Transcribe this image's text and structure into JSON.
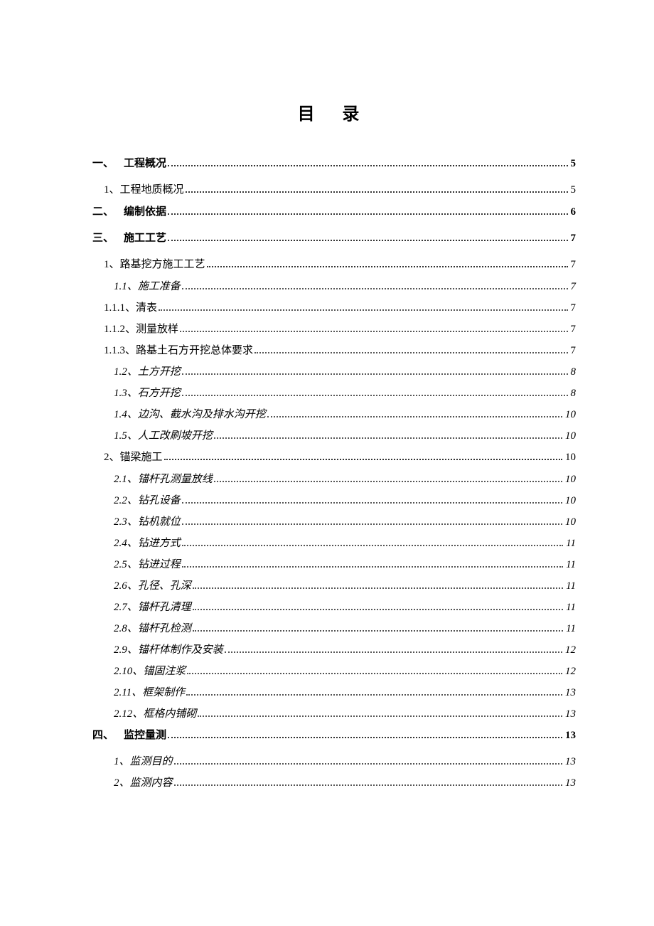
{
  "title": "目 录",
  "toc": [
    {
      "cls": "lvl1",
      "marker": "一、",
      "label": "工程概况",
      "page": "5"
    },
    {
      "cls": "lvl2",
      "marker": "1、",
      "label": "工程地质概况",
      "page": "5"
    },
    {
      "cls": "lvl1",
      "marker": "二、",
      "label": "编制依据",
      "page": "6"
    },
    {
      "cls": "lvl1",
      "marker": "三、",
      "label": "施工工艺",
      "page": "7"
    },
    {
      "cls": "lvl2",
      "marker": "1、",
      "label": "路基挖方施工工艺",
      "page": "7"
    },
    {
      "cls": "lvl3",
      "marker": "1.1、",
      "label": "施工准备 ",
      "page": "7"
    },
    {
      "cls": "lvl3b",
      "marker": "1.1.1、",
      "label": "清表",
      "page": "7"
    },
    {
      "cls": "lvl3b",
      "marker": "1.1.2、",
      "label": "测量放样",
      "page": "7"
    },
    {
      "cls": "lvl3b",
      "marker": "1.1.3、",
      "label": "路基土石方开挖总体要求",
      "page": "7"
    },
    {
      "cls": "lvl3",
      "marker": "1.2、",
      "label": "土方开挖 ",
      "page": "8"
    },
    {
      "cls": "lvl3",
      "marker": "1.3、",
      "label": "石方开挖 ",
      "page": "8"
    },
    {
      "cls": "lvl3",
      "marker": "1.4、",
      "label": "边沟、截水沟及排水沟开挖 ",
      "page": "10"
    },
    {
      "cls": "lvl3",
      "marker": "1.5、",
      "label": "人工改刷坡开挖 ",
      "page": "10"
    },
    {
      "cls": "lvl2",
      "marker": "2、",
      "label": "锚梁施工",
      "page": "10"
    },
    {
      "cls": "lvl3",
      "marker": "2.1、",
      "label": "锚杆孔测量放线 ",
      "page": "10"
    },
    {
      "cls": "lvl3",
      "marker": "2.2、",
      "label": "钻孔设备 ",
      "page": "10"
    },
    {
      "cls": "lvl3",
      "marker": "2.3、",
      "label": "钻机就位 ",
      "page": "10"
    },
    {
      "cls": "lvl3",
      "marker": "2.4、",
      "label": "钻进方式 ",
      "page": "11"
    },
    {
      "cls": "lvl3",
      "marker": "2.5、",
      "label": "钻进过程 ",
      "page": "11"
    },
    {
      "cls": "lvl3",
      "marker": "2.6、",
      "label": "孔径、孔深 ",
      "page": "11"
    },
    {
      "cls": "lvl3",
      "marker": "2.7、",
      "label": "锚杆孔清理 ",
      "page": "11"
    },
    {
      "cls": "lvl3",
      "marker": "2.8、",
      "label": "锚杆孔检测 ",
      "page": "11"
    },
    {
      "cls": "lvl3",
      "marker": "2.9、",
      "label": "锚杆体制作及安装 ",
      "page": "12"
    },
    {
      "cls": "lvl3",
      "marker": "2.10、",
      "label": "锚固注浆 ",
      "page": "12"
    },
    {
      "cls": "lvl3",
      "marker": "2.11、",
      "label": "框架制作 ",
      "page": "13"
    },
    {
      "cls": "lvl3",
      "marker": "2.12、",
      "label": "框格内铺砌 ",
      "page": "13"
    },
    {
      "cls": "lvl1",
      "marker": "四、",
      "label": "监控量测",
      "page": "13"
    },
    {
      "cls": "lvl3",
      "marker": "1、",
      "label": "监测目的 ",
      "page": "13"
    },
    {
      "cls": "lvl3",
      "marker": "2、",
      "label": "监测内容 ",
      "page": "13"
    }
  ]
}
